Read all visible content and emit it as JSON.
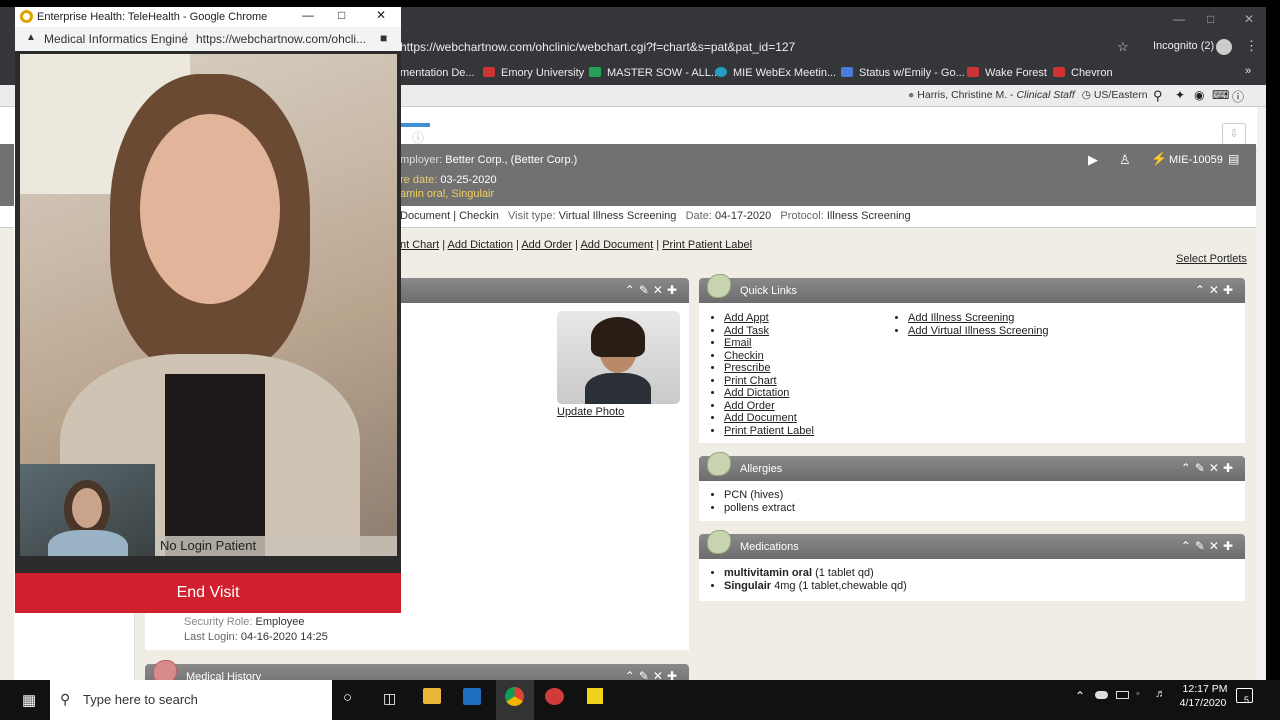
{
  "browser": {
    "url": "https://webchartnow.com/ohclinic/webchart.cgi?f=chart&s=pat&pat_id=127",
    "incognito": "Incognito (2)",
    "bookmarks": [
      {
        "label": "mentation De...",
        "color": "#cc3333"
      },
      {
        "label": "Emory University",
        "color": "#cc3333"
      },
      {
        "label": "MASTER SOW - ALL...",
        "color": "#23a455"
      },
      {
        "label": "MIE WebEx Meetin...",
        "color": "#21a1c4"
      },
      {
        "label": "Status w/Emily - Go...",
        "color": "#4a7bd8"
      },
      {
        "label": "Wake Forest",
        "color": "#cc3333"
      },
      {
        "label": "Chevron",
        "color": "#cc3333"
      }
    ]
  },
  "userbar": {
    "user": "Harris, Christine M.",
    "role": "Clinical Staff",
    "timezone": "US/Eastern"
  },
  "patient": {
    "employer_label": "mployer:",
    "employer": "Better Corp., (Better Corp.)",
    "date_label": "re date:",
    "date": "03-25-2020",
    "meds_line": "amin oral, Singulair",
    "mrn": "MIE-10059"
  },
  "visit": {
    "actions": "Document | Checkin",
    "type_label": "Visit type:",
    "type": "Virtual Illness Screening",
    "date_label": "Date:",
    "date": "04-17-2020",
    "protocol_label": "Protocol:",
    "protocol": "Illness Screening"
  },
  "actionlinks": [
    "nt Chart",
    "Add Dictation",
    "Add Order",
    "Add Document",
    "Print Patient Label"
  ],
  "select_portlets": "Select Portlets",
  "update_photo": "Update Photo",
  "security_role_label": "Security Role:",
  "security_role": "Employee",
  "last_login_label": "Last Login:",
  "last_login": "04-16-2020 14:25",
  "medical_history": "Medical History",
  "quicklinks": {
    "title": "Quick Links",
    "col1": [
      "Add Appt",
      "Add Task",
      "Email",
      "Checkin",
      "Prescribe",
      "Print Chart",
      "Add Dictation",
      "Add Order",
      "Add Document",
      "Print Patient Label"
    ],
    "col2": [
      "Add Illness Screening",
      "Add Virtual Illness Screening"
    ]
  },
  "allergies": {
    "title": "Allergies",
    "items": [
      "PCN (hives)",
      "pollens extract"
    ]
  },
  "medications": {
    "title": "Medications",
    "items": [
      {
        "name": "multivitamin oral",
        "detail": "(1 tablet qd)"
      },
      {
        "name": "Singulair",
        "detail": "4mg (1 tablet,chewable qd)"
      }
    ]
  },
  "popup": {
    "title": "Enterprise Health: TeleHealth - Google Chrome",
    "site": "Medical Informatics Engine",
    "url": "https://webchartnow.com/ohcli...",
    "self_label": "No Login Patient",
    "end_button": "End Visit"
  },
  "taskbar": {
    "search_placeholder": "Type here to search",
    "time": "12:17 PM",
    "date": "4/17/2020",
    "notifications": "5"
  }
}
